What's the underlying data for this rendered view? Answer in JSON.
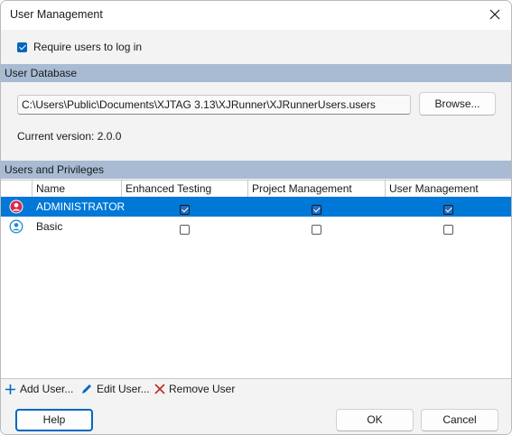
{
  "window": {
    "title": "User Management"
  },
  "login": {
    "label": "Require users to log in",
    "checked": true
  },
  "database": {
    "header": "User Database",
    "path": "C:\\Users\\Public\\Documents\\XJTAG 3.13\\XJRunner\\XJRunnerUsers.users",
    "browse_label": "Browse...",
    "version_text": "Current version: 2.0.0"
  },
  "privileges": {
    "header": "Users and Privileges",
    "columns": [
      "Name",
      "Enhanced Testing",
      "Project Management",
      "User Management"
    ],
    "rows": [
      {
        "name": "ADMINISTRATOR",
        "enhanced_testing": true,
        "project_management": true,
        "user_management": true,
        "selected": true,
        "icon": "admin-user-icon"
      },
      {
        "name": "Basic",
        "enhanced_testing": false,
        "project_management": false,
        "user_management": false,
        "selected": false,
        "icon": "user-icon"
      }
    ]
  },
  "toolbar": {
    "add_label": "Add User...",
    "edit_label": "Edit User...",
    "remove_label": "Remove User"
  },
  "buttons": {
    "help": "Help",
    "ok": "OK",
    "cancel": "Cancel"
  },
  "colors": {
    "section_header": "#a8bbd3",
    "selection": "#0078d7",
    "accent": "#0067c0",
    "admin_icon": "#d9294b",
    "user_icon": "#1e8bd8",
    "remove": "#c42b1c"
  }
}
